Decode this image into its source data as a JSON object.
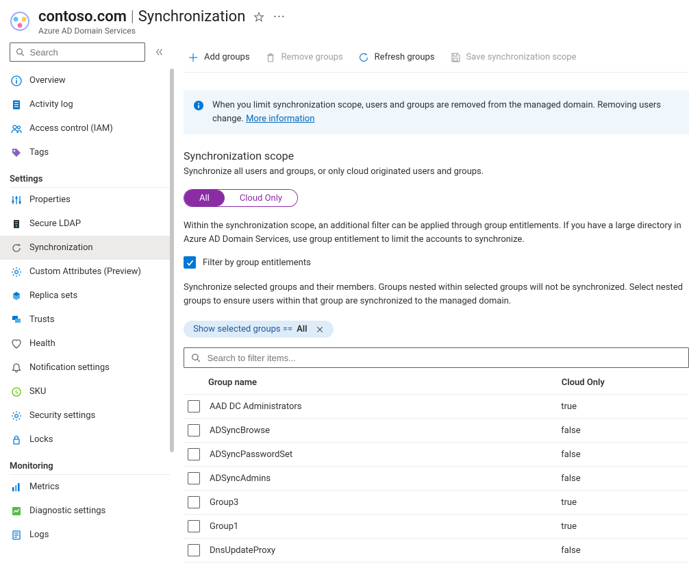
{
  "header": {
    "resource_name": "contoso.com",
    "blade_name": "Synchronization",
    "resource_type": "Azure AD Domain Services"
  },
  "sidebar": {
    "search_placeholder": "Search",
    "sections": [
      {
        "items": [
          {
            "icon": "info-icon",
            "label": "Overview"
          },
          {
            "icon": "log-icon",
            "label": "Activity log"
          },
          {
            "icon": "people-icon",
            "label": "Access control (IAM)"
          },
          {
            "icon": "tag-icon",
            "label": "Tags"
          }
        ]
      },
      {
        "title": "Settings",
        "items": [
          {
            "icon": "tuning-icon",
            "label": "Properties"
          },
          {
            "icon": "server-icon",
            "label": "Secure LDAP"
          },
          {
            "icon": "sync-icon",
            "label": "Synchronization",
            "selected": true
          },
          {
            "icon": "gear-icon",
            "label": "Custom Attributes (Preview)"
          },
          {
            "icon": "replica-icon",
            "label": "Replica sets"
          },
          {
            "icon": "trust-icon",
            "label": "Trusts"
          },
          {
            "icon": "health-icon",
            "label": "Health"
          },
          {
            "icon": "bell-icon",
            "label": "Notification settings"
          },
          {
            "icon": "sku-icon",
            "label": "SKU"
          },
          {
            "icon": "security-icon",
            "label": "Security settings"
          },
          {
            "icon": "lock-icon",
            "label": "Locks"
          }
        ]
      },
      {
        "title": "Monitoring",
        "items": [
          {
            "icon": "metrics-icon",
            "label": "Metrics"
          },
          {
            "icon": "diag-icon",
            "label": "Diagnostic settings"
          },
          {
            "icon": "logs-icon",
            "label": "Logs"
          }
        ]
      }
    ]
  },
  "toolbar": {
    "add_groups": "Add groups",
    "remove_groups": "Remove groups",
    "refresh_groups": "Refresh groups",
    "save_scope": "Save synchronization scope"
  },
  "banner": {
    "text": "When you limit synchronization scope, users and groups are removed from the managed domain. Removing users change. ",
    "link_text": "More information"
  },
  "scope": {
    "title": "Synchronization scope",
    "desc": "Synchronize all users and groups, or only cloud originated users and groups.",
    "seg_all": "All",
    "seg_cloud": "Cloud Only",
    "entitlements_para": "Within the synchronization scope, an additional filter can be applied through group entitlements. If you have a large directory in Azure AD Domain Services, use group entitlement to limit the accounts to synchronize.",
    "checkbox_label": "Filter by group entitlements",
    "nested_para": "Synchronize selected groups and their members. Groups nested within selected groups will not be synchronized. Select nested groups to ensure users within that group are synchronized to the managed domain."
  },
  "filter_pill": {
    "prefix": "Show selected groups == ",
    "value": "All"
  },
  "groups_search_placeholder": "Search to filter items...",
  "groups_table": {
    "col_name": "Group name",
    "col_cloud": "Cloud Only",
    "rows": [
      {
        "name": "AAD DC Administrators",
        "cloud": "true"
      },
      {
        "name": "ADSyncBrowse",
        "cloud": "false"
      },
      {
        "name": "ADSyncPasswordSet",
        "cloud": "false"
      },
      {
        "name": "ADSyncAdmins",
        "cloud": "false"
      },
      {
        "name": "Group3",
        "cloud": "true"
      },
      {
        "name": "Group1",
        "cloud": "true"
      },
      {
        "name": "DnsUpdateProxy",
        "cloud": "false"
      }
    ]
  }
}
